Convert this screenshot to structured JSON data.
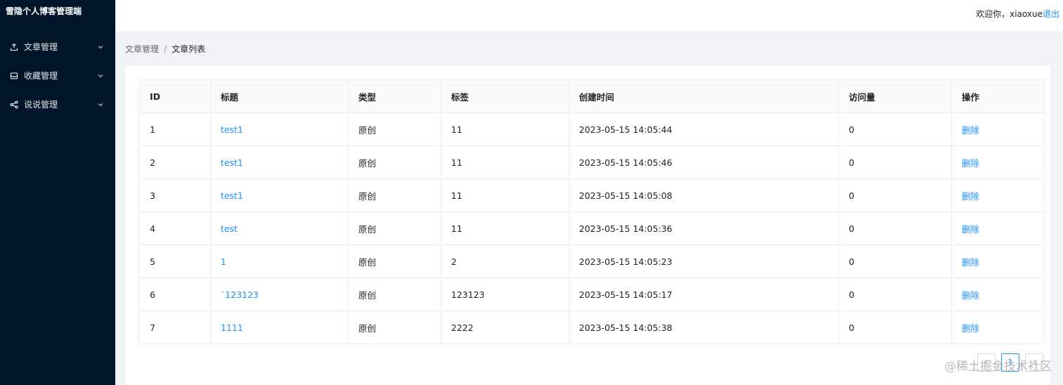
{
  "app": {
    "title": "雪隐个人博客管理端"
  },
  "sidebar": {
    "items": [
      {
        "label": "文章管理",
        "icon": "upload-icon"
      },
      {
        "label": "收藏管理",
        "icon": "inbox-icon"
      },
      {
        "label": "说说管理",
        "icon": "share-icon"
      }
    ]
  },
  "header": {
    "greeting": "欢迎你，xiaoxue",
    "logout_label": "退出"
  },
  "breadcrumb": {
    "items": [
      "文章管理",
      "文章列表"
    ],
    "separator": "/"
  },
  "table": {
    "columns": [
      "ID",
      "标题",
      "类型",
      "标签",
      "创建时间",
      "访问量",
      "操作"
    ],
    "rows": [
      {
        "id": "1",
        "title": "test1",
        "type": "原创",
        "tag": "11",
        "created": "2023-05-15 14:05:44",
        "views": "0",
        "action": "删除"
      },
      {
        "id": "2",
        "title": "test1",
        "type": "原创",
        "tag": "11",
        "created": "2023-05-15 14:05:46",
        "views": "0",
        "action": "删除"
      },
      {
        "id": "3",
        "title": "test1",
        "type": "原创",
        "tag": "11",
        "created": "2023-05-15 14:05:08",
        "views": "0",
        "action": "删除"
      },
      {
        "id": "4",
        "title": "test",
        "type": "原创",
        "tag": "11",
        "created": "2023-05-15 14:05:36",
        "views": "0",
        "action": "删除"
      },
      {
        "id": "5",
        "title": "1",
        "type": "原创",
        "tag": "2",
        "created": "2023-05-15 14:05:23",
        "views": "0",
        "action": "删除"
      },
      {
        "id": "6",
        "title": "`123123",
        "type": "原创",
        "tag": "123123",
        "created": "2023-05-15 14:05:17",
        "views": "0",
        "action": "删除"
      },
      {
        "id": "7",
        "title": "1111",
        "type": "原创",
        "tag": "2222",
        "created": "2023-05-15 14:05:38",
        "views": "0",
        "action": "删除"
      }
    ]
  },
  "pagination": {
    "prev_icon": "chevron-left-icon",
    "current_page": "1",
    "next_icon": "chevron-right-icon"
  },
  "watermark": "@稀土掘金技术社区",
  "colors": {
    "sidebar_bg": "#001529",
    "link": "#1890ff",
    "page_bg": "#f0f2f5"
  }
}
